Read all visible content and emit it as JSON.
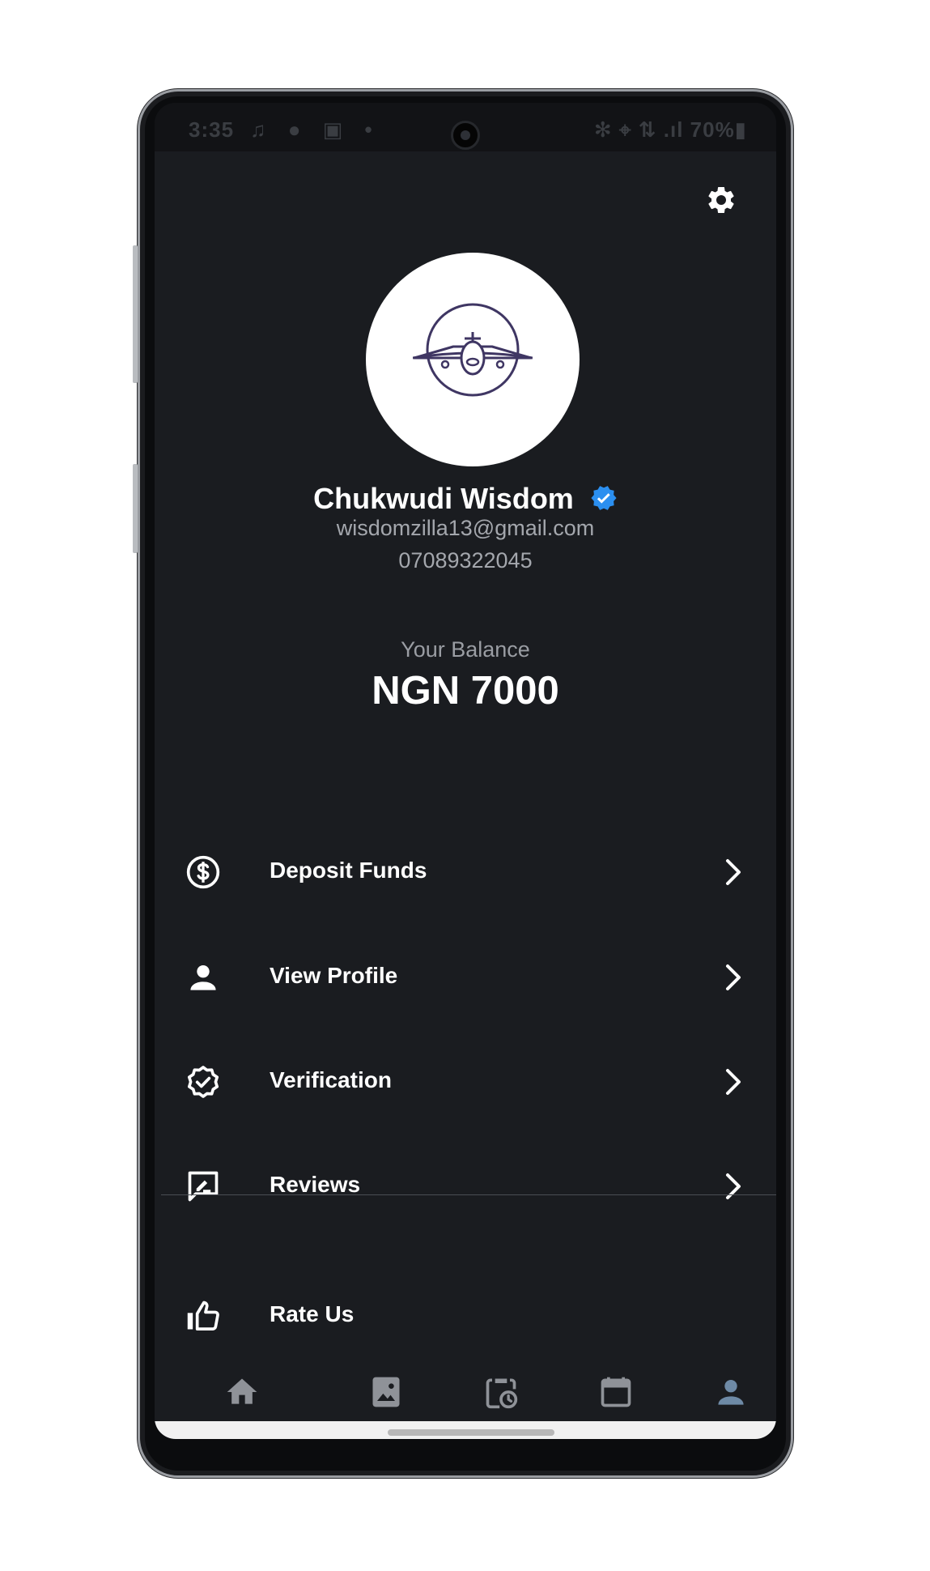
{
  "status_bar": {
    "time": "3:35",
    "icons": "♫ ● ▣ •",
    "right": "✻ ⌖ ⇅ .ıl 70%▮"
  },
  "profile": {
    "name": "Chukwudi Wisdom",
    "email": "wisdomzilla13@gmail.com",
    "phone": "07089322045",
    "verified": true
  },
  "balance": {
    "label": "Your Balance",
    "value": "NGN 7000"
  },
  "menu": [
    {
      "label": "Deposit Funds",
      "icon": "dollar-circle-icon"
    },
    {
      "label": "View Profile",
      "icon": "person-icon"
    },
    {
      "label": "Verification",
      "icon": "verified-badge-icon"
    },
    {
      "label": "Reviews",
      "icon": "rate-review-icon"
    },
    {
      "label": "Rate Us",
      "icon": "thumbs-up-icon"
    }
  ],
  "bottom_nav": [
    {
      "icon": "home-icon",
      "active": false
    },
    {
      "icon": "image-icon",
      "active": false
    },
    {
      "icon": "clipboard-clock-icon",
      "active": false
    },
    {
      "icon": "calendar-icon",
      "active": false
    },
    {
      "icon": "person-icon",
      "active": true
    }
  ],
  "colors": {
    "background": "#1a1c20",
    "text_primary": "#ffffff",
    "text_secondary": "#a4a7ad",
    "verified_blue": "#2b8ff0",
    "nav_inactive": "#8f9298",
    "nav_active": "#6e8aa6",
    "avatar_logo": "#3f3663"
  }
}
